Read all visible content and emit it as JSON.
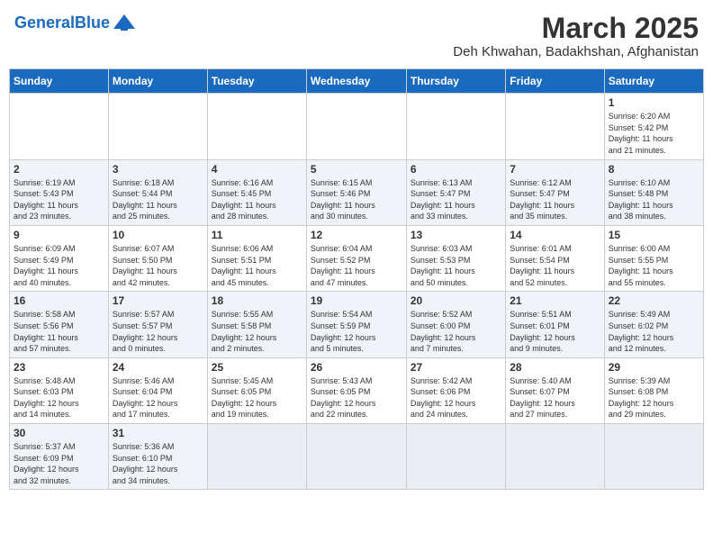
{
  "header": {
    "logo_general": "General",
    "logo_blue": "Blue",
    "month": "March 2025",
    "location": "Deh Khwahan, Badakhshan, Afghanistan"
  },
  "days_of_week": [
    "Sunday",
    "Monday",
    "Tuesday",
    "Wednesday",
    "Thursday",
    "Friday",
    "Saturday"
  ],
  "weeks": [
    [
      {
        "day": "",
        "info": ""
      },
      {
        "day": "",
        "info": ""
      },
      {
        "day": "",
        "info": ""
      },
      {
        "day": "",
        "info": ""
      },
      {
        "day": "",
        "info": ""
      },
      {
        "day": "",
        "info": ""
      },
      {
        "day": "1",
        "info": "Sunrise: 6:20 AM\nSunset: 5:42 PM\nDaylight: 11 hours\nand 21 minutes."
      }
    ],
    [
      {
        "day": "2",
        "info": "Sunrise: 6:19 AM\nSunset: 5:43 PM\nDaylight: 11 hours\nand 23 minutes."
      },
      {
        "day": "3",
        "info": "Sunrise: 6:18 AM\nSunset: 5:44 PM\nDaylight: 11 hours\nand 25 minutes."
      },
      {
        "day": "4",
        "info": "Sunrise: 6:16 AM\nSunset: 5:45 PM\nDaylight: 11 hours\nand 28 minutes."
      },
      {
        "day": "5",
        "info": "Sunrise: 6:15 AM\nSunset: 5:46 PM\nDaylight: 11 hours\nand 30 minutes."
      },
      {
        "day": "6",
        "info": "Sunrise: 6:13 AM\nSunset: 5:47 PM\nDaylight: 11 hours\nand 33 minutes."
      },
      {
        "day": "7",
        "info": "Sunrise: 6:12 AM\nSunset: 5:47 PM\nDaylight: 11 hours\nand 35 minutes."
      },
      {
        "day": "8",
        "info": "Sunrise: 6:10 AM\nSunset: 5:48 PM\nDaylight: 11 hours\nand 38 minutes."
      }
    ],
    [
      {
        "day": "9",
        "info": "Sunrise: 6:09 AM\nSunset: 5:49 PM\nDaylight: 11 hours\nand 40 minutes."
      },
      {
        "day": "10",
        "info": "Sunrise: 6:07 AM\nSunset: 5:50 PM\nDaylight: 11 hours\nand 42 minutes."
      },
      {
        "day": "11",
        "info": "Sunrise: 6:06 AM\nSunset: 5:51 PM\nDaylight: 11 hours\nand 45 minutes."
      },
      {
        "day": "12",
        "info": "Sunrise: 6:04 AM\nSunset: 5:52 PM\nDaylight: 11 hours\nand 47 minutes."
      },
      {
        "day": "13",
        "info": "Sunrise: 6:03 AM\nSunset: 5:53 PM\nDaylight: 11 hours\nand 50 minutes."
      },
      {
        "day": "14",
        "info": "Sunrise: 6:01 AM\nSunset: 5:54 PM\nDaylight: 11 hours\nand 52 minutes."
      },
      {
        "day": "15",
        "info": "Sunrise: 6:00 AM\nSunset: 5:55 PM\nDaylight: 11 hours\nand 55 minutes."
      }
    ],
    [
      {
        "day": "16",
        "info": "Sunrise: 5:58 AM\nSunset: 5:56 PM\nDaylight: 11 hours\nand 57 minutes."
      },
      {
        "day": "17",
        "info": "Sunrise: 5:57 AM\nSunset: 5:57 PM\nDaylight: 12 hours\nand 0 minutes."
      },
      {
        "day": "18",
        "info": "Sunrise: 5:55 AM\nSunset: 5:58 PM\nDaylight: 12 hours\nand 2 minutes."
      },
      {
        "day": "19",
        "info": "Sunrise: 5:54 AM\nSunset: 5:59 PM\nDaylight: 12 hours\nand 5 minutes."
      },
      {
        "day": "20",
        "info": "Sunrise: 5:52 AM\nSunset: 6:00 PM\nDaylight: 12 hours\nand 7 minutes."
      },
      {
        "day": "21",
        "info": "Sunrise: 5:51 AM\nSunset: 6:01 PM\nDaylight: 12 hours\nand 9 minutes."
      },
      {
        "day": "22",
        "info": "Sunrise: 5:49 AM\nSunset: 6:02 PM\nDaylight: 12 hours\nand 12 minutes."
      }
    ],
    [
      {
        "day": "23",
        "info": "Sunrise: 5:48 AM\nSunset: 6:03 PM\nDaylight: 12 hours\nand 14 minutes."
      },
      {
        "day": "24",
        "info": "Sunrise: 5:46 AM\nSunset: 6:04 PM\nDaylight: 12 hours\nand 17 minutes."
      },
      {
        "day": "25",
        "info": "Sunrise: 5:45 AM\nSunset: 6:05 PM\nDaylight: 12 hours\nand 19 minutes."
      },
      {
        "day": "26",
        "info": "Sunrise: 5:43 AM\nSunset: 6:05 PM\nDaylight: 12 hours\nand 22 minutes."
      },
      {
        "day": "27",
        "info": "Sunrise: 5:42 AM\nSunset: 6:06 PM\nDaylight: 12 hours\nand 24 minutes."
      },
      {
        "day": "28",
        "info": "Sunrise: 5:40 AM\nSunset: 6:07 PM\nDaylight: 12 hours\nand 27 minutes."
      },
      {
        "day": "29",
        "info": "Sunrise: 5:39 AM\nSunset: 6:08 PM\nDaylight: 12 hours\nand 29 minutes."
      }
    ],
    [
      {
        "day": "30",
        "info": "Sunrise: 5:37 AM\nSunset: 6:09 PM\nDaylight: 12 hours\nand 32 minutes."
      },
      {
        "day": "31",
        "info": "Sunrise: 5:36 AM\nSunset: 6:10 PM\nDaylight: 12 hours\nand 34 minutes."
      },
      {
        "day": "",
        "info": ""
      },
      {
        "day": "",
        "info": ""
      },
      {
        "day": "",
        "info": ""
      },
      {
        "day": "",
        "info": ""
      },
      {
        "day": "",
        "info": ""
      }
    ]
  ]
}
